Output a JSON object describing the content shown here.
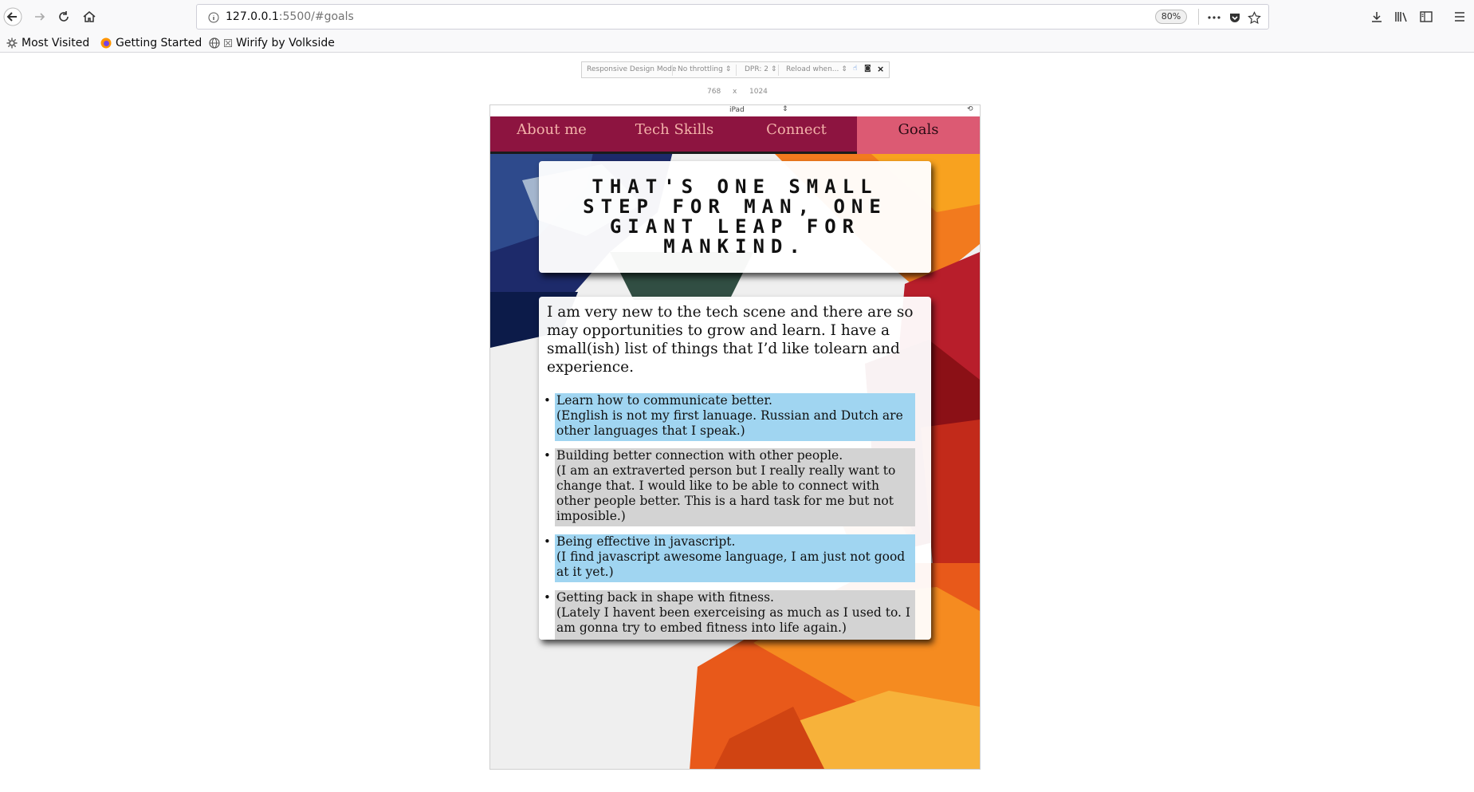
{
  "browser": {
    "url_host": "127.0.0.1",
    "url_rest": ":5500/#goals",
    "zoom": "80%",
    "bookmarks": [
      {
        "label": "Most Visited"
      },
      {
        "label": "Getting Started"
      },
      {
        "label": "Wirify by Volkside"
      }
    ]
  },
  "rdm": {
    "title": "Responsive Design Mode",
    "throttling": "No throttling",
    "dpr": "DPR: 2",
    "reload": "Reload when...",
    "width": "768",
    "times": "x",
    "height": "1024",
    "device": "iPad"
  },
  "site": {
    "nav": [
      {
        "label": "About me"
      },
      {
        "label": "Tech Skills"
      },
      {
        "label": "Connect"
      },
      {
        "label": "Goals"
      }
    ],
    "quote": "That's one small step for man, one giant leap for mankind.",
    "intro": "I am very new to the tech scene and there are so may opportunities to grow and learn. I have a small(ish) list of things that I’d like tolearn and experience.",
    "goals": [
      {
        "title": "Learn how to communicate better.",
        "detail": "(English is not my first lanuage. Russian and Dutch are other languages that I speak.)"
      },
      {
        "title": "Building better connection with other people.",
        "detail": "(I am an extraverted person but I really really want to change that. I would like to be able to connect with other people better. This is a hard task for me but not imposible.)"
      },
      {
        "title": "Being effective in javascript.",
        "detail": "(I find javascript awesome language, I am just not good at it yet.)"
      },
      {
        "title": "Getting back in shape with fitness.",
        "detail": "(Lately I havent been exerceising as much as I used to. I am gonna try to embed fitness into life again.)"
      }
    ]
  },
  "colors": {
    "nav_bg": "#8d1440",
    "nav_active": "#dc5a73",
    "goal_blue": "#a0d5f1",
    "goal_grey": "#d3d3d3"
  }
}
